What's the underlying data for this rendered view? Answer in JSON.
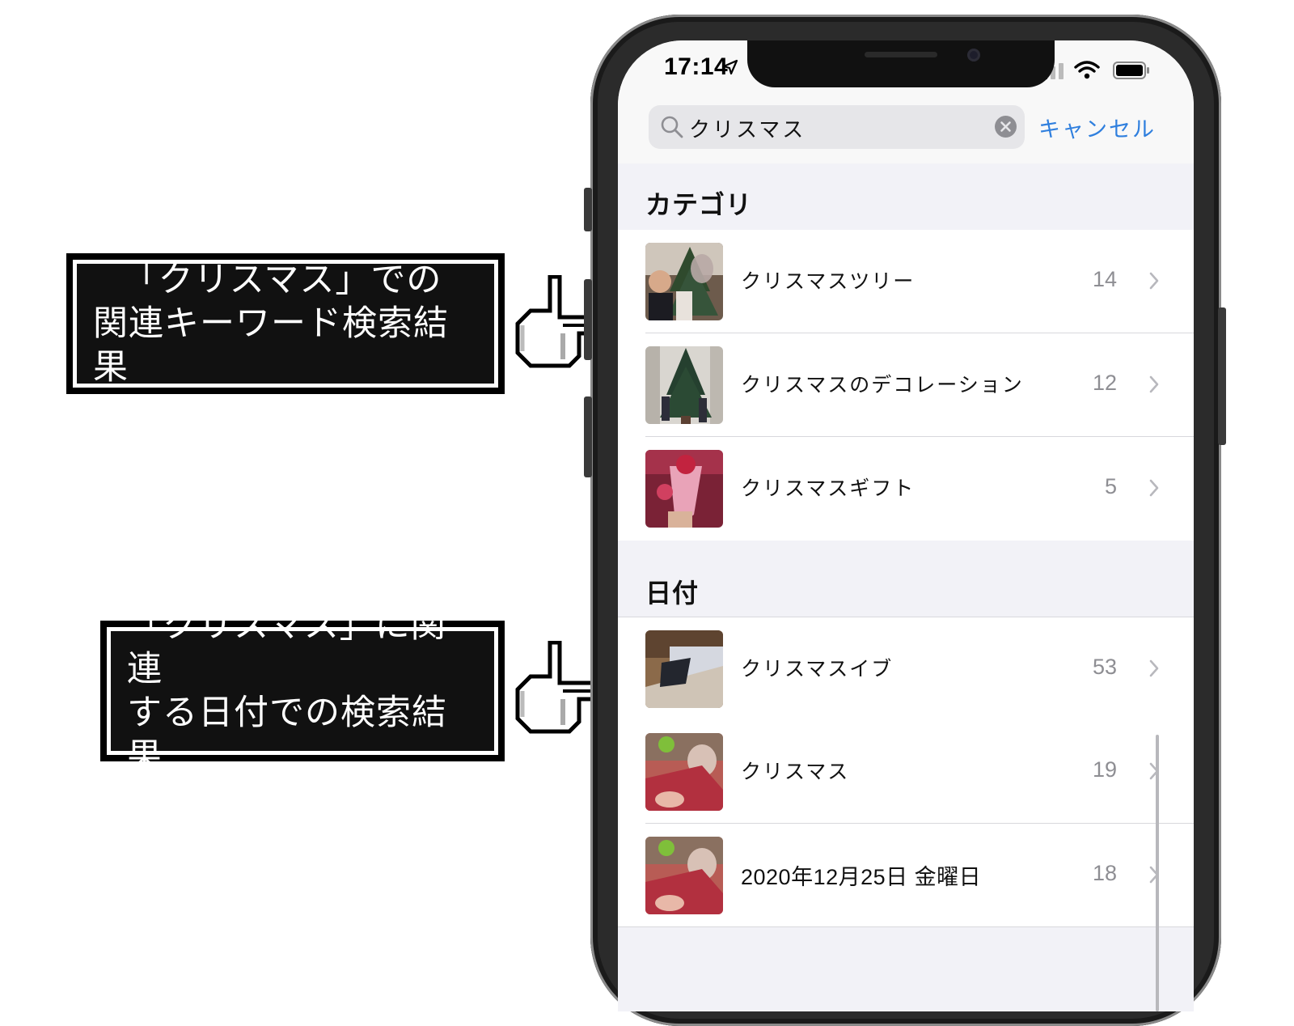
{
  "callouts": [
    {
      "line1": "「クリスマス」での",
      "line2": "関連キーワード検索結果"
    },
    {
      "line1": "「クリスマス」に関連",
      "line2": "する日付での検索結果"
    }
  ],
  "status_bar": {
    "time": "17:14"
  },
  "search": {
    "query": "クリスマス",
    "cancel_label": "キャンセル"
  },
  "sections": [
    {
      "title": "カテゴリ",
      "items": [
        {
          "label": "クリスマスツリー",
          "count": "14"
        },
        {
          "label": "クリスマスのデコレーション",
          "count": "12"
        },
        {
          "label": "クリスマスギフト",
          "count": "5"
        }
      ]
    },
    {
      "title": "日付",
      "items": [
        {
          "label": "クリスマスイブ",
          "count": "53"
        },
        {
          "label": "クリスマス",
          "count": "19"
        },
        {
          "label": "2020年12月25日 金曜日",
          "count": "18"
        }
      ]
    }
  ],
  "colors": {
    "accent": "#2f7fde",
    "secondary_text": "#8e8e93",
    "group_background": "#f2f2f7"
  }
}
